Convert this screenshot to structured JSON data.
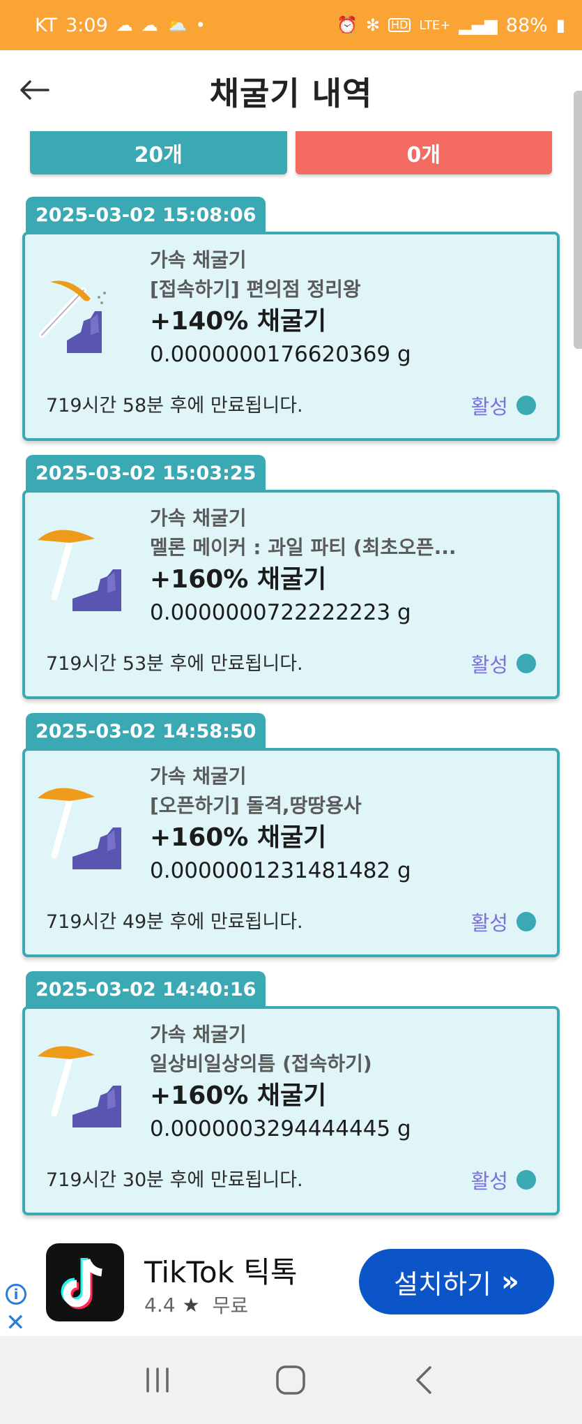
{
  "status_bar": {
    "carrier": "KT",
    "time": "3:09",
    "network": "LTE+",
    "battery": "88%"
  },
  "header": {
    "title": "채굴기 내역"
  },
  "tabs": [
    {
      "label": "20개"
    },
    {
      "label": "0개"
    }
  ],
  "cards": [
    {
      "date": "2025-03-02 15:08:06",
      "type": "가속 채굴기",
      "name": "[접속하기] 편의점 정리왕",
      "boost": "+140% 채굴기",
      "amount": "0.0000000176620369 g",
      "expire": "719시간 58분 후에 만료됩니다.",
      "status": "활성"
    },
    {
      "date": "2025-03-02 15:03:25",
      "type": "가속 채굴기",
      "name": "멜론 메이커 : 과일 파티 (최초오픈...",
      "boost": "+160% 채굴기",
      "amount": "0.0000000722222223 g",
      "expire": "719시간 53분 후에 만료됩니다.",
      "status": "활성"
    },
    {
      "date": "2025-03-02 14:58:50",
      "type": "가속 채굴기",
      "name": "[오픈하기] 돌격,땅땅용사",
      "boost": "+160% 채굴기",
      "amount": "0.0000001231481482 g",
      "expire": "719시간 49분 후에 만료됩니다.",
      "status": "활성"
    },
    {
      "date": "2025-03-02 14:40:16",
      "type": "가속 채굴기",
      "name": "일상비일상의틈 (접속하기)",
      "boost": "+160% 채굴기",
      "amount": "0.0000003294444445 g",
      "expire": "719시간 30분 후에 만료됩니다.",
      "status": "활성"
    }
  ],
  "ad": {
    "app_name": "TikTok 틱톡",
    "rating": "4.4",
    "price": "무료",
    "button_label": "설치하기"
  },
  "colors": {
    "status_bar": "#f9a434",
    "teal": "#3aa9b4",
    "coral": "#f46b62",
    "card_bg": "#dff5f7",
    "status_purple": "#7b71d9",
    "ad_button": "#0c55c9"
  }
}
